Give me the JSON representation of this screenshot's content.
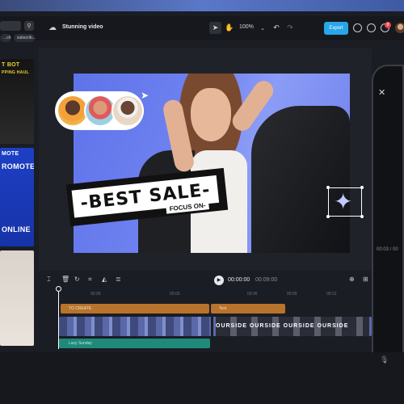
{
  "header": {
    "project_title": "Stunning video",
    "zoom": "100%",
    "export_label": "Export",
    "notification_count": "8"
  },
  "sidebar": {
    "chips": [
      "...ch",
      "subscrib..."
    ],
    "filter_icon": "filter-icon",
    "thumbnails": [
      {
        "line1": "T BOT",
        "line2": "PPING HAUL"
      },
      {
        "line1": "MOTE",
        "line2": "ROMOTE",
        "line3": "ONLINE"
      },
      {
        "line1": ""
      }
    ]
  },
  "canvas": {
    "sale_text": "-BEST SALE-",
    "sale_sub": "FOCUS ON-"
  },
  "timeline": {
    "current_time": "00:00:00",
    "total_time": "00:09:00",
    "ruler": [
      "00:00",
      "00:03",
      "00:06",
      "00:09",
      "00:12"
    ],
    "tracks": {
      "text1": "TO CREATE",
      "text2": "Text",
      "video_label": "OURSIDE OURSIDE OURSIDE OURSIDE",
      "audio": "Lazy Sunday"
    }
  },
  "phone": {
    "time": "00:03 / 00"
  },
  "colors": {
    "accent": "#27a6e8",
    "text_track": "#b8732c",
    "audio_track": "#1f8a7a"
  }
}
